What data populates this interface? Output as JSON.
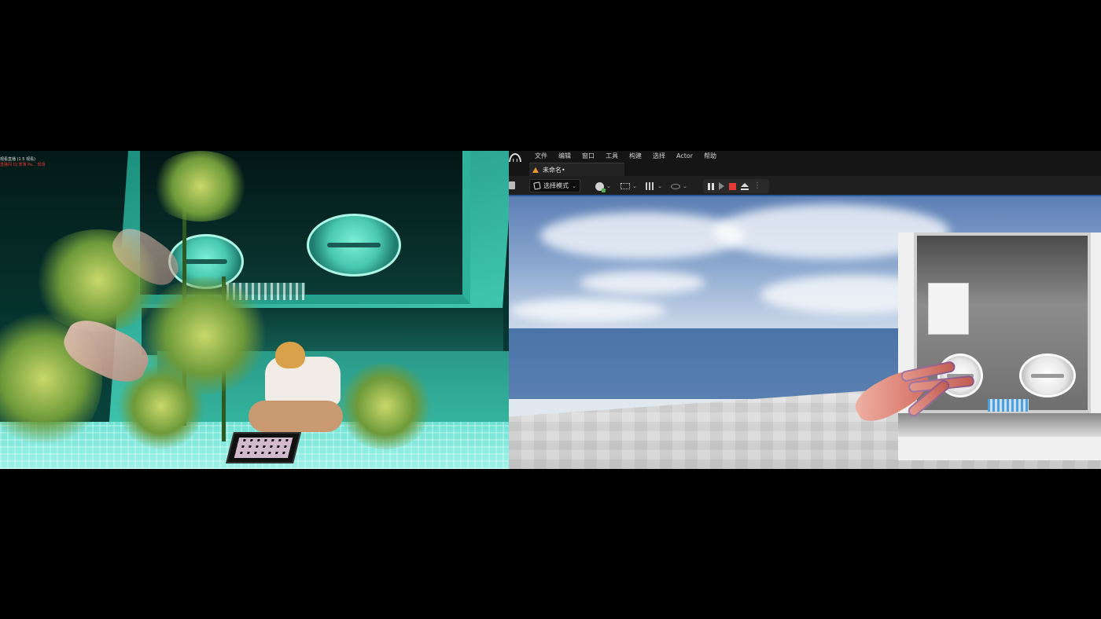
{
  "left_panel": {
    "overlay_line1": "观看直播 (1 5 观看)",
    "overlay_line2": "直播间 DJ 表演 Pa… 现场"
  },
  "editor": {
    "menu": [
      "文件",
      "编辑",
      "窗口",
      "工具",
      "构建",
      "选择",
      "Actor",
      "帮助"
    ],
    "doc_tab": "未命名•",
    "mode_label": "选择模式",
    "colors": {
      "accent_blue": "#2a5a9a",
      "stop_red": "#e53935",
      "warning_orange": "#e79a2b",
      "add_green": "#4caf50"
    },
    "icons": {
      "logo": "unreal-logo-icon",
      "save": "save-icon",
      "add_actor": "add-actor-icon",
      "blueprint": "blueprint-icon",
      "cinematics": "clapperboard-icon",
      "platforms": "eye-icon",
      "pause": "pause-icon",
      "step": "frame-step-icon",
      "stop": "stop-icon",
      "eject": "eject-icon",
      "more": "more-options-icon"
    }
  }
}
